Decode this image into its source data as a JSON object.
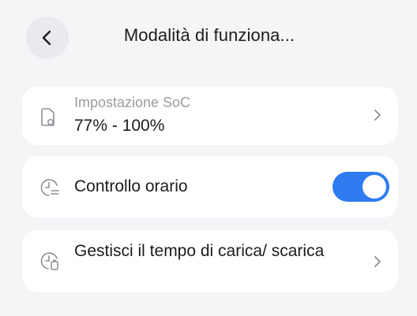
{
  "header": {
    "title": "Modalità di funziona..."
  },
  "soc": {
    "label": "Impostazione SoC",
    "value": "77% - 100%"
  },
  "orario": {
    "label": "Controllo orario",
    "enabled": true,
    "accent": "#2f7bf0"
  },
  "gestisci": {
    "label": "Gestisci il tempo di carica/ scarica"
  },
  "icons": {
    "back": "chevron-left-icon",
    "soc": "battery-icon",
    "orario": "clock-settings-icon",
    "gestisci": "clock-battery-icon",
    "chevron": "chevron-right-icon"
  }
}
